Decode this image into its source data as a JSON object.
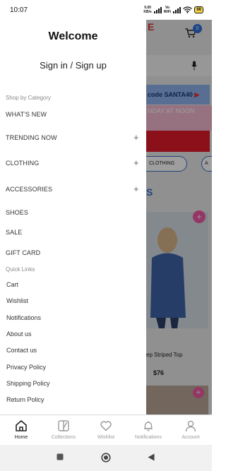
{
  "status_bar": {
    "time": "10:07",
    "net_speed_value": "0.00",
    "net_speed_unit": "KB/s",
    "vo": "Vo",
    "wifi_label": "WiFi",
    "battery": "66"
  },
  "drawer": {
    "title": "Welcome",
    "sign_in": "Sign in / Sign up",
    "shop_by_category_label": "Shop by Category",
    "categories": [
      {
        "label": "WHAT'S NEW",
        "expandable": false
      },
      {
        "label": "TRENDING NOW",
        "expandable": true
      },
      {
        "label": "CLOTHING",
        "expandable": true
      },
      {
        "label": "ACCESSORIES",
        "expandable": true
      },
      {
        "label": "SHOES",
        "expandable": false
      },
      {
        "label": "SALE",
        "expandable": false
      },
      {
        "label": "GIFT CARD",
        "expandable": false
      }
    ],
    "plus_symbol": "+",
    "quick_links_label": "Quick Links",
    "quick_links": [
      "Cart",
      "Wishlist",
      "Notifications",
      "About us",
      "Contact us",
      "Privacy Policy",
      "Shipping Policy",
      "Return Policy"
    ]
  },
  "background": {
    "logo_fragment": "E",
    "cart_badge": "0",
    "promo_code": "code SANTA40",
    "promo_day": "NDAY AT NOON",
    "chip_clothing": "CLOTHING",
    "chip_second": "A",
    "section_fragment": "S",
    "plus_symbol": "+",
    "product_name": "ep Striped Top",
    "product_price": "$76"
  },
  "bottom_nav": [
    {
      "label": "Home",
      "icon": "home-icon",
      "active": true
    },
    {
      "label": "Collections",
      "icon": "collections-icon",
      "active": false
    },
    {
      "label": "Wishlist",
      "icon": "heart-icon",
      "active": false
    },
    {
      "label": "Notifications",
      "icon": "bell-icon",
      "active": false
    },
    {
      "label": "Account",
      "icon": "person-icon",
      "active": false
    }
  ],
  "colors": {
    "accent_blue": "#2f6fd6",
    "promo_red": "#e11b2a",
    "plus_pink": "#ef5aa5"
  }
}
